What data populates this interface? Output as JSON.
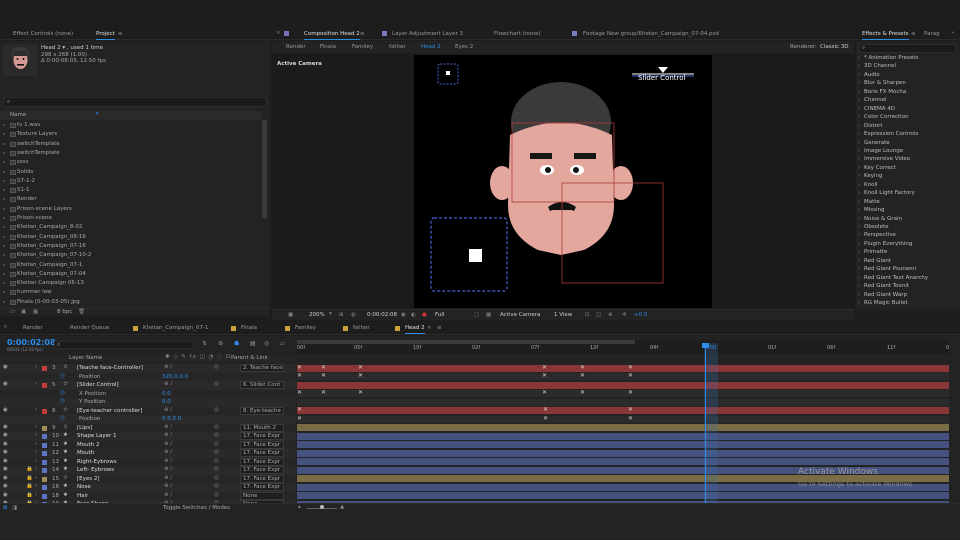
{
  "left_tabs": [
    "Effect Controls (none)",
    "Project"
  ],
  "project": {
    "item_name": "Head 2 ▾ , used 1 time",
    "item_dims": "298 x 268 (1.00)",
    "item_dur": "Δ 0:00:08:03, 12.50 fps",
    "search_placeholder": "⌕",
    "col_name": "Name",
    "items": [
      "tv 1.wav",
      "Texture Layers",
      "switchTemplate",
      "switchTemplate",
      "ssss",
      "Solids",
      "S7-1-2",
      "S1-1",
      "Render",
      "Prison-scene Layers",
      "Prison-scene",
      "Khetan_Campaign_8-02",
      "Khetan_Campaign_08-16",
      "Khetan_Campaign_07-16",
      "Khetan_Campaign_07-10-2",
      "Khetan_Campaign_07-1",
      "Khetan_Campaign_07-04",
      "Khetan Campaign 06-13",
      "hummer law",
      "Finala (0-00-03-05).jpg"
    ],
    "bpc": "8 bpc"
  },
  "center_tabs": [
    "Composition Head 2",
    "Layer Adjustment Layer 3",
    "Flowchart (none)",
    "Footage New group/Khetan_Campaign_07-04.psd"
  ],
  "comp_tabs": [
    "Render",
    "Finala",
    "Familey",
    "father",
    "Head 2",
    "Eyes 2"
  ],
  "renderer_label": "Renderer:",
  "renderer_value": "Classic 3D",
  "active_camera": "Active Camera",
  "slider_control": "Slider Control",
  "viewer_bar": {
    "zoom": "200%",
    "time": "0:00:02:08",
    "res": "Full",
    "camera": "Active Camera",
    "views": "1 View",
    "exposure": "+0.0"
  },
  "right_tabs": [
    "Effects & Presets",
    "Parag"
  ],
  "effects": [
    "* Animation Presets",
    "3D Channel",
    "Audio",
    "Blur & Sharpen",
    "Boris FX Mocha",
    "Channel",
    "CINEMA 4D",
    "Color Correction",
    "Distort",
    "Expression Controls",
    "Generate",
    "Image Lounge",
    "Immersive Video",
    "Key Correct",
    "Keying",
    "Knoll",
    "Knoll Light Factory",
    "Matte",
    "Missing",
    "Noise & Grain",
    "Obsolete",
    "Perspective",
    "Plugin Everything",
    "Primatte",
    "Red Giant",
    "Red Giant Psunami",
    "Red Giant Text Anarchy",
    "Red Giant Toonit",
    "Red Giant Warp",
    "RG Magic Bullet"
  ],
  "timeline_tabs": [
    "Render",
    "Render Queue",
    "Khetan_Campaign_07-1",
    "Finala",
    "Familey",
    "father",
    "Head 2"
  ],
  "timecode": "0:00:02:08",
  "timecode_sub": "00033 (12.50 fps)",
  "col_layer": "Layer Name",
  "col_parent": "Parent & Link",
  "ruler_labels": [
    "00f",
    "05f",
    "10f",
    "02f",
    "07f",
    "12f",
    "04f",
    "09f",
    "01f",
    "06f",
    "11f",
    "0"
  ],
  "layers": [
    {
      "num": "3",
      "name": "[Teache face-Controller]",
      "parent": "2. Teache face",
      "color": "#c23c3c",
      "type": "layer",
      "star": "☆"
    },
    {
      "num": "",
      "name": "Position",
      "parent": "",
      "value": "320.0,0.0",
      "type": "prop"
    },
    {
      "num": "5",
      "name": "[Slider Control]",
      "parent": "6. Slider Cont",
      "color": "#c23c3c",
      "type": "layer",
      "star": "☆"
    },
    {
      "num": "",
      "name": "X Position",
      "parent": "",
      "value": "0.0",
      "type": "prop"
    },
    {
      "num": "",
      "name": "Y Position",
      "parent": "",
      "value": "0.0",
      "type": "prop"
    },
    {
      "num": "8",
      "name": "[Eye-teacher controller]",
      "parent": "8. Eye-teache",
      "color": "#c23c3c",
      "type": "layer",
      "star": "☆"
    },
    {
      "num": "",
      "name": "Position",
      "parent": "",
      "value": "0.0,0.0",
      "type": "prop"
    },
    {
      "num": "9",
      "name": "[Lips]",
      "parent": "11. Mouth 2",
      "color": "#a08d5a",
      "type": "layer",
      "star": "☆"
    },
    {
      "num": "10",
      "name": "Shape Layer 1",
      "parent": "17. Face Expr",
      "color": "#5d74c4",
      "type": "layer",
      "star": "★"
    },
    {
      "num": "11",
      "name": "Mouth 2",
      "parent": "17. Face Expr",
      "color": "#5d74c4",
      "type": "layer",
      "star": "★"
    },
    {
      "num": "12",
      "name": "Mouth",
      "parent": "17. Face Expr",
      "color": "#5d74c4",
      "type": "layer",
      "star": "★"
    },
    {
      "num": "13",
      "name": "Right-Eybrows",
      "parent": "17. Face Expr",
      "color": "#5d74c4",
      "type": "layer",
      "star": "★"
    },
    {
      "num": "14",
      "name": "Left- Eybrows",
      "parent": "17. Face Expr",
      "color": "#5d74c4",
      "type": "layer",
      "star": "★"
    },
    {
      "num": "15",
      "name": "[Eyes 2]",
      "parent": "17. Face Expr",
      "color": "#a08d5a",
      "type": "layer",
      "star": "☆"
    },
    {
      "num": "16",
      "name": "Nose",
      "parent": "17. Face Expr",
      "color": "#5d74c4",
      "type": "layer",
      "star": "★"
    },
    {
      "num": "18",
      "name": "Hair",
      "parent": "None",
      "color": "#5d74c4",
      "type": "layer",
      "star": "★"
    },
    {
      "num": "19",
      "name": "Face Shape",
      "parent": "None",
      "color": "#5d74c4",
      "type": "layer",
      "star": "★"
    }
  ],
  "toggle_label": "Toggle Switches / Modes",
  "watermark_title": "Activate Windows",
  "watermark_sub": "Go to Settings to activate Windows."
}
